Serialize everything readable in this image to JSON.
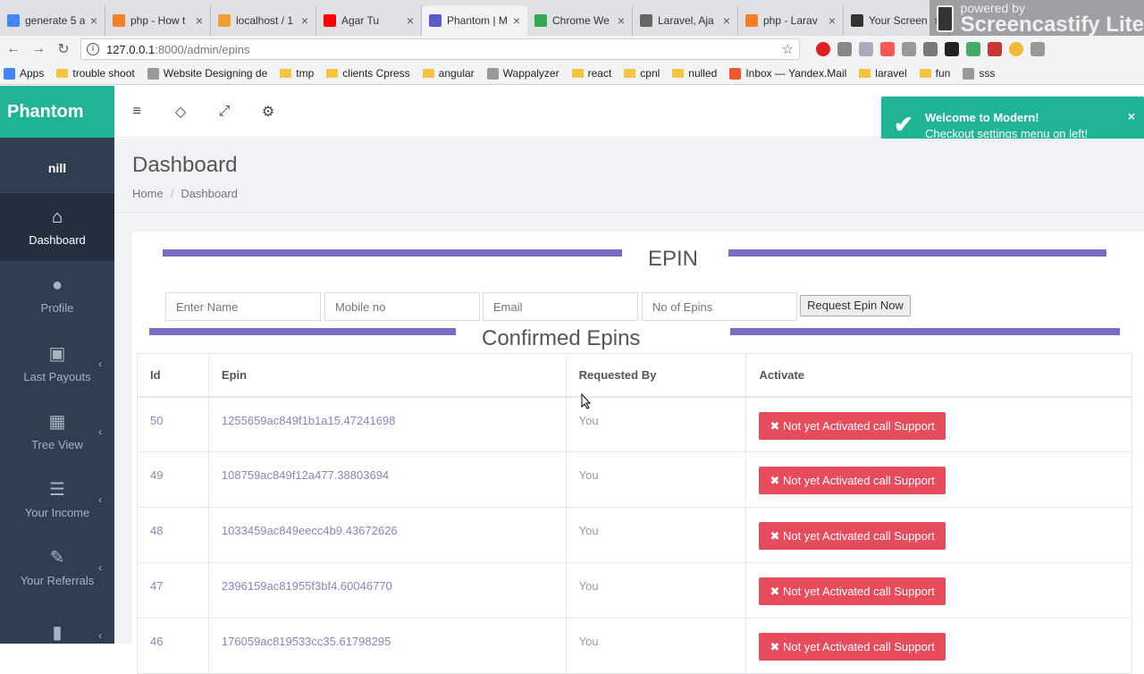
{
  "browser": {
    "tabs": [
      {
        "label": "generate 5 a",
        "color": "#4285f4",
        "active": false
      },
      {
        "label": "php - How t",
        "color": "#f48024",
        "active": false
      },
      {
        "label": "localhost / 1",
        "color": "#f0a030",
        "active": false
      },
      {
        "label": "Agar Tu",
        "color": "#ff0000",
        "active": false
      },
      {
        "label": "Phantom | M",
        "color": "#5a5ac8",
        "active": true
      },
      {
        "label": "Chrome We",
        "color": "#34a853",
        "active": false
      },
      {
        "label": "Laravel, Aja",
        "color": "#666666",
        "active": false
      },
      {
        "label": "php - Larav",
        "color": "#f48024",
        "active": false
      },
      {
        "label": "Your Screen",
        "color": "#333333",
        "active": false
      }
    ],
    "url_host": "127.0.0.1",
    "url_rest": ":8000/admin/epins",
    "bookmarks": [
      {
        "label": "Apps",
        "icon": "apps-icon"
      },
      {
        "label": "trouble shoot",
        "icon": "folder-icon"
      },
      {
        "label": "Website Designing de",
        "icon": "site-icon"
      },
      {
        "label": "tmp",
        "icon": "folder-icon"
      },
      {
        "label": "clients Cpress",
        "icon": "folder-icon"
      },
      {
        "label": "angular",
        "icon": "folder-icon"
      },
      {
        "label": "Wappalyzer",
        "icon": "page-icon"
      },
      {
        "label": "react",
        "icon": "folder-icon"
      },
      {
        "label": "cpnl",
        "icon": "folder-icon"
      },
      {
        "label": "nulled",
        "icon": "folder-icon"
      },
      {
        "label": "Inbox — Yandex.Mail",
        "icon": "mail-icon"
      },
      {
        "label": "laravel",
        "icon": "folder-icon"
      },
      {
        "label": "fun",
        "icon": "folder-icon"
      },
      {
        "label": "sss",
        "icon": "site-icon"
      }
    ],
    "screencastify": {
      "small": "powered by",
      "big": "Screencastify Lite"
    }
  },
  "sidebar": {
    "brand": "Phantom",
    "user": "nill",
    "items": [
      {
        "label": "Dashboard",
        "icon": "home-icon",
        "glyph": "⌂",
        "active": true,
        "caret": false
      },
      {
        "label": "Profile",
        "icon": "user-icon",
        "glyph": "●",
        "active": false,
        "caret": false
      },
      {
        "label": "Last Payouts",
        "icon": "briefcase-icon",
        "glyph": "▣",
        "active": false,
        "caret": true
      },
      {
        "label": "Tree View",
        "icon": "grid-icon",
        "glyph": "▦",
        "active": false,
        "caret": true
      },
      {
        "label": "Your Income",
        "icon": "list-icon",
        "glyph": "☰",
        "active": false,
        "caret": true
      },
      {
        "label": "Your Referrals",
        "icon": "edit-icon",
        "glyph": "✎",
        "active": false,
        "caret": true
      },
      {
        "label": "",
        "icon": "bar-chart-icon",
        "glyph": "▮",
        "active": false,
        "caret": true
      }
    ]
  },
  "topbar": {
    "icons": [
      {
        "name": "menu-icon",
        "glyph": "≡"
      },
      {
        "name": "diamond-icon",
        "glyph": "◇"
      },
      {
        "name": "expand-icon",
        "glyph": "⤢"
      },
      {
        "name": "settings-icon",
        "glyph": "⚙"
      }
    ]
  },
  "toast": {
    "title": "Welcome to Modern!",
    "message": "Checkout settings menu on left!",
    "close": "×"
  },
  "page": {
    "title": "Dashboard",
    "breadcrumb": {
      "home": "Home",
      "sep": "/",
      "current": "Dashboard"
    }
  },
  "epin_form": {
    "title": "EPIN",
    "name_placeholder": "Enter Name",
    "mobile_placeholder": "Mobile no",
    "email_placeholder": "Email",
    "count_placeholder": "No of Epins",
    "submit_label": "Request Epin Now"
  },
  "confirmed": {
    "title": "Confirmed Epins",
    "columns": [
      "Id",
      "Epin",
      "Requested By",
      "Activate"
    ],
    "rows": [
      {
        "id": "50",
        "epin": "1255659ac849f1b1a15.47241698",
        "requested_by": "You",
        "action": "✖ Not yet Activated call Support"
      },
      {
        "id": "49",
        "epin": "108759ac849f12a477.38803694",
        "requested_by": "You",
        "action": "✖ Not yet Activated call Support"
      },
      {
        "id": "48",
        "epin": "1033459ac849eecc4b9.43672626",
        "requested_by": "You",
        "action": "✖ Not yet Activated call Support"
      },
      {
        "id": "47",
        "epin": "2396159ac81955f3bf4.60046770",
        "requested_by": "You",
        "action": "✖ Not yet Activated call Support"
      },
      {
        "id": "46",
        "epin": "176059ac819533cc35.61798295",
        "requested_by": "You",
        "action": "✖ Not yet Activated call Support"
      }
    ]
  },
  "colors": {
    "brand": "#1fb493",
    "sidebar": "#2f3e50",
    "accent_bar": "#7b6bc4",
    "danger": "#e74c5c"
  }
}
